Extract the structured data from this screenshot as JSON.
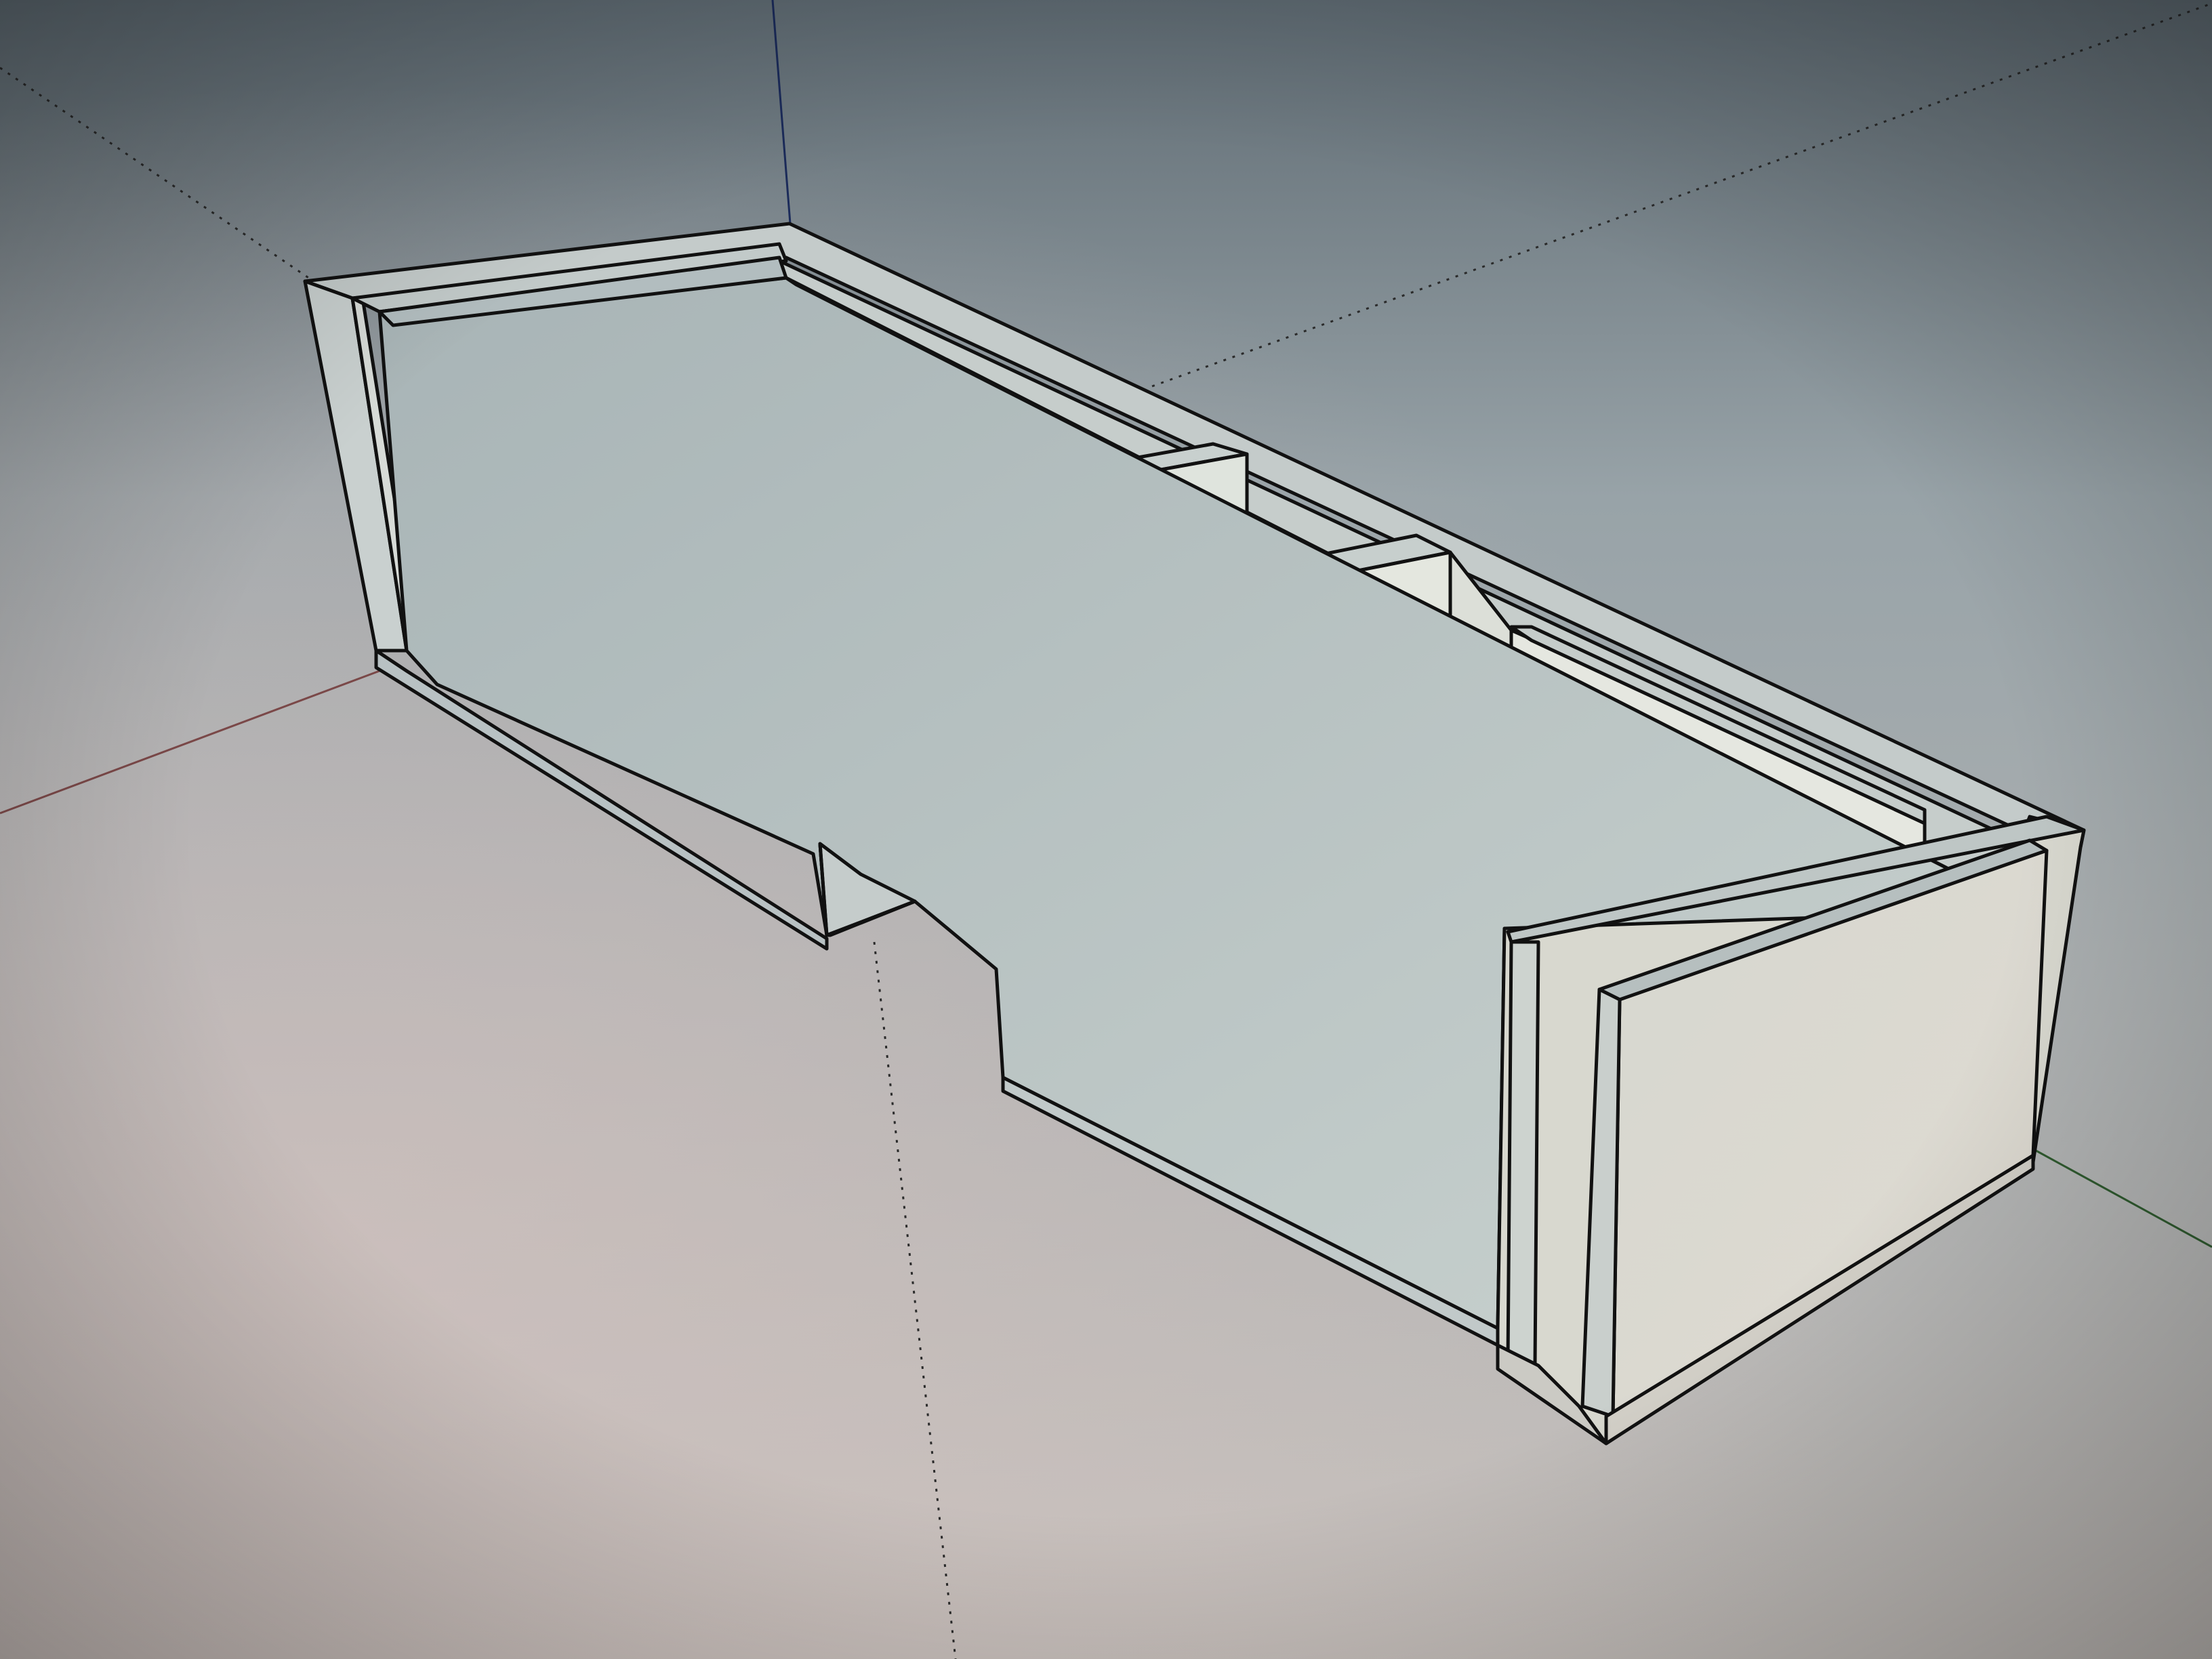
{
  "app": {
    "view": "3d-modeling-viewport",
    "style": "hidden-line-with-face-shading"
  },
  "colors": {
    "sky_top": "#5f6b73",
    "sky_mid": "#98a3a8",
    "ground_left": "#c9c0bd",
    "ground_right": "#c8c8c2",
    "edge": "#111111",
    "face_light": "#e6e9e2",
    "face_mid": "#cfd7d4",
    "face_shadow": "#aeb8b8",
    "face_warm": "#ddd8cd",
    "axis_red": "#7a4848",
    "axis_green": "#2f5a2f",
    "axis_blue": "#1b2b5a",
    "axis_dotted": "#333333"
  },
  "model": {
    "name": "",
    "parts": [
      "outer-frame",
      "inner-box",
      "divider-left",
      "divider-middle",
      "divider-right",
      "front-panel",
      "end-cap-panel",
      "notch-cutout"
    ]
  },
  "axes": {
    "show_red": true,
    "show_green": true,
    "show_blue": true
  }
}
